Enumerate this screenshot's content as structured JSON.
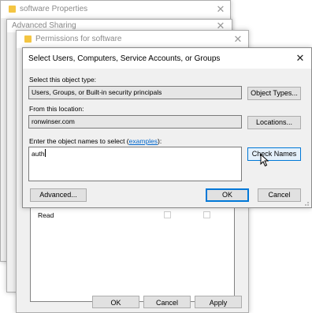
{
  "bg_window": {
    "title": "software Properties",
    "close_glyph": "✕"
  },
  "adv_window": {
    "title": "Advanced Sharing",
    "close_glyph": "✕"
  },
  "perm_window": {
    "title": "Permissions for software",
    "close_glyph": "✕",
    "row_label": "Read",
    "ok_label": "OK",
    "cancel_label": "Cancel",
    "apply_label": "Apply"
  },
  "select_dialog": {
    "title": "Select Users, Computers, Service Accounts, or Groups",
    "close_glyph": "✕",
    "object_type_label": "Select this object type:",
    "object_type_value": "Users, Groups, or Built-in security principals",
    "object_types_button": "Object Types...",
    "location_label": "From this location:",
    "location_value": "ronwinser.com",
    "locations_button": "Locations...",
    "names_label_prefix": "Enter the object names to select (",
    "names_label_link": "examples",
    "names_label_suffix": "):",
    "names_value": "auth",
    "check_names_button": "Check Names",
    "advanced_button": "Advanced...",
    "ok_button": "OK",
    "cancel_button": "Cancel"
  },
  "colors": {
    "accent": "#0078d7",
    "link": "#0066cc"
  }
}
